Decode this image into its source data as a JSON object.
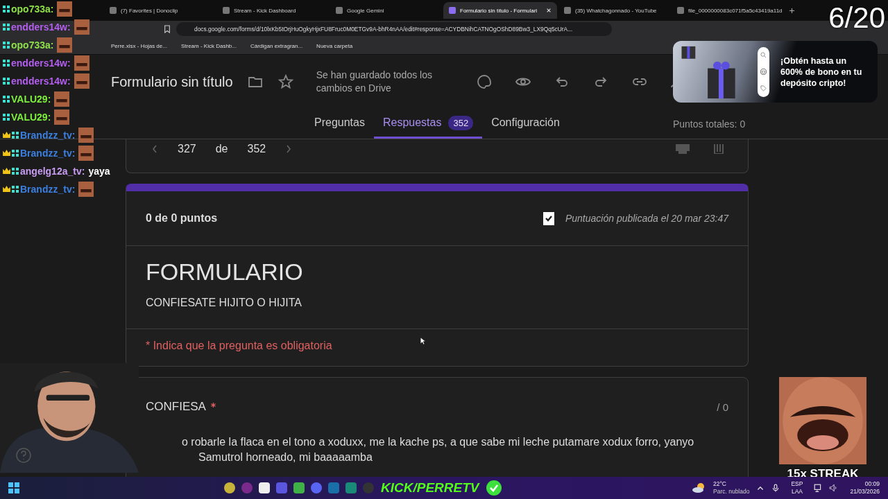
{
  "browser": {
    "tabs": [
      {
        "label": "(7) Favorites | Donoclip",
        "selected": false
      },
      {
        "label": "Stream - Kick Dashboard",
        "selected": false
      },
      {
        "label": "Google Gemini",
        "selected": false
      },
      {
        "label": "Formulario sin título - Formulari",
        "selected": true
      },
      {
        "label": "(35) Whatchagonnado - YouTube",
        "selected": false
      },
      {
        "label": "file_0000000083c071f5a5c43419a11d",
        "selected": false
      }
    ],
    "url": "docs.google.com/forms/d/10lxKb5tOrjHuOgkyHjxFU8Fruc0M0ETGv9A-bhR4nAA/edit#response=ACYDBNihCATNOgOShD89Bw3_LX9Qq5cUrA...",
    "bookmarks": [
      "Perre.xlsx - Hojas de...",
      "Stream - Kick Dashb...",
      "Cárdigan extragran...",
      "Nueva carpeta"
    ]
  },
  "form": {
    "title": "Formulario sin título",
    "save_status": "Se han guardado todos los cambios en Drive",
    "tabs": [
      {
        "label": "Preguntas",
        "selected": false
      },
      {
        "label": "Respuestas",
        "badge": "352",
        "selected": true
      },
      {
        "label": "Configuración",
        "selected": false
      }
    ],
    "total_points": "Puntos totales: 0",
    "navigator": {
      "current": "327",
      "of": "de",
      "total": "352"
    },
    "score": "0 de 0 puntos",
    "published": "Puntuación publicada el 20 mar 23:47",
    "heading": "FORMULARIO",
    "description": "CONFIESATE HIJITO O HIJITA",
    "required_note": "* Indica que la pregunta es obligatoria",
    "question": {
      "title": "CONFIESA",
      "required": true,
      "points": "/ 0",
      "answer": [
        "o robarle la flaca en el tono a xoduxx, me la kache ps, a que sabe mi leche putamare xodux forro, yanyo",
        "Samutrol horneado, mi baaaaamba"
      ]
    }
  },
  "chat": [
    {
      "user": "opo733a:",
      "color": "#8ee04a",
      "crown": false
    },
    {
      "user": "endders14w:",
      "color": "#b45ef0",
      "crown": false
    },
    {
      "user": "opo733a:",
      "color": "#8ee04a",
      "crown": false
    },
    {
      "user": "endders14w:",
      "color": "#b45ef0",
      "crown": false
    },
    {
      "user": "endders14w:",
      "color": "#b45ef0",
      "crown": false
    },
    {
      "user": "VALU29:",
      "color": "#7df03c",
      "crown": false
    },
    {
      "user": "VALU29:",
      "color": "#7df03c",
      "crown": false
    },
    {
      "user": "Brandzz_tv:",
      "color": "#3b7fe0",
      "crown": true
    },
    {
      "user": "Brandzz_tv:",
      "color": "#3b7fe0",
      "crown": true
    },
    {
      "user": "angelg12a_tv:",
      "color": "#c79cf2",
      "crown": true,
      "text": "yaya"
    },
    {
      "user": "Brandzz_tv:",
      "color": "#3b7fe0",
      "crown": true
    }
  ],
  "goal_counter": "6/20",
  "ad": {
    "text": "¡Obtén hasta un 600% de bono en tu depósito cripto!"
  },
  "streak": "15x STREAK",
  "stream_brand": "KICK/PERRETV",
  "taskbar": {
    "temperature": "22°C",
    "weather": "Parc. nublado",
    "lang_1": "ESP",
    "lang_2": "LAA",
    "time": "00:09",
    "date": "21/03/2026"
  }
}
